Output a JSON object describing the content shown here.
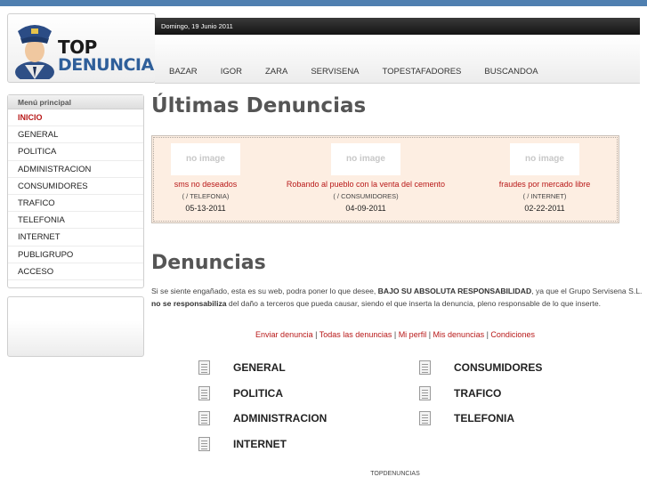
{
  "header": {
    "logo_top": "TOP",
    "logo_bottom": "DENUNCIAS",
    "date": "Domingo, 19 Junio 2011",
    "nav": [
      "BAZAR",
      "IGOR",
      "ZARA",
      "SERVISENA",
      "TOPESTAFADORES",
      "BUSCANDOA"
    ]
  },
  "sidebar": {
    "title": "Menú principal",
    "items": [
      "INICIO",
      "GENERAL",
      "POLITICA",
      "ADMINISTRACION",
      "CONSUMIDORES",
      "TRAFICO",
      "TELEFONIA",
      "INTERNET",
      "PUBLIGRUPO",
      "ACCESO"
    ]
  },
  "latest": {
    "heading": "Últimas Denuncias",
    "cards": [
      {
        "image_text": "no image",
        "title": "sms no deseados",
        "category": "( / TELEFONIA)",
        "date": "05-13-2011"
      },
      {
        "image_text": "no image",
        "title": "Robando al pueblo con la venta del cemento",
        "category": "( / CONSUMIDORES)",
        "date": "04-09-2011"
      },
      {
        "image_text": "no image",
        "title": "fraudes por mercado libre",
        "category": "( / INTERNET)",
        "date": "02-22-2011"
      }
    ]
  },
  "denuncias": {
    "heading": "Denuncias",
    "intro_1": "Si se siente engañado, esta es su web, podra poner lo que desee, ",
    "intro_bold_1": "BAJO SU ABSOLUTA RESPONSABILIDAD",
    "intro_2": ", ya que el Grupo Servisena S.L. ",
    "intro_bold_2": "no se responsabiliza",
    "intro_3": " del daño a terceros que pueda causar, siendo el que inserta la denuncia, pleno responsable de lo que inserte.",
    "links": [
      "Enviar denuncia",
      "Todas las denuncias",
      "Mi perfil",
      "Mis denuncias",
      "Condiciones"
    ],
    "link_separator": " | ",
    "categories_left": [
      "GENERAL",
      "POLITICA",
      "ADMINISTRACION",
      "INTERNET"
    ],
    "categories_right": [
      "CONSUMIDORES",
      "TRAFICO",
      "TELEFONIA"
    ]
  },
  "footer": {
    "text": "TOPDENUNCIAS"
  },
  "colors": {
    "accent_red": "#b81818",
    "brand_blue": "#2f5f9a",
    "highlight_bg": "#fdeee2"
  }
}
